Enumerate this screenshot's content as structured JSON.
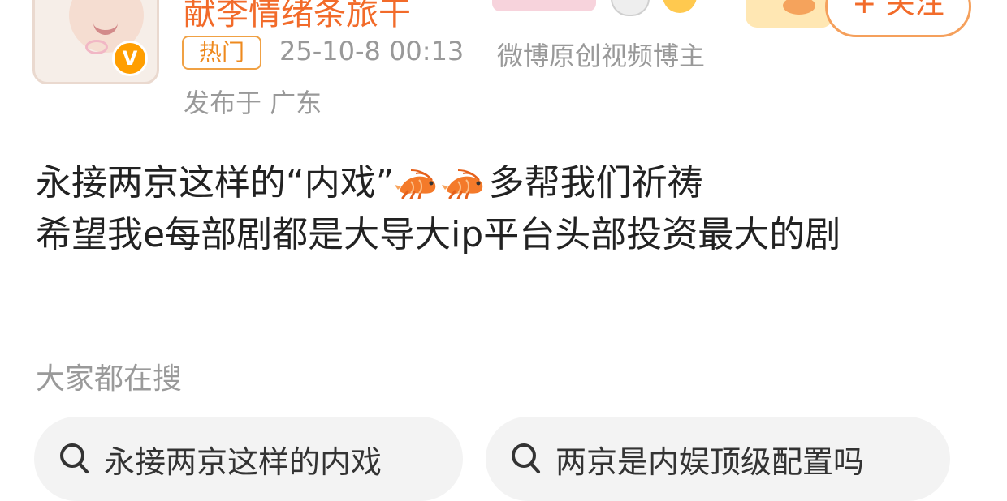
{
  "user": {
    "name": "献李情绪条旅干",
    "vip_badge": "V",
    "follow_label": "+ 关注"
  },
  "meta": {
    "hot_tag": "热门",
    "time": "25-10-8 00:13",
    "author_title": "微博原创视频博主",
    "location": "发布于 广东"
  },
  "post": {
    "part1": "永接两京这样的“内戏”",
    "part2": "多帮我们祈祷",
    "line2": "希望我e每部剧都是大导大ip平台头部投资最大的剧"
  },
  "trending": {
    "title": "大家都在搜",
    "items": [
      {
        "label": "永接两京这样的内戏"
      },
      {
        "label": "两京是内娱顶级配置吗"
      }
    ]
  },
  "icons": {
    "emoji": "shrimp-icon",
    "search": "search-icon"
  },
  "colors": {
    "username": "#f26b2a",
    "accent": "#ee8a1e",
    "meta_text": "#999999",
    "pill_bg": "#f3f3f3"
  }
}
